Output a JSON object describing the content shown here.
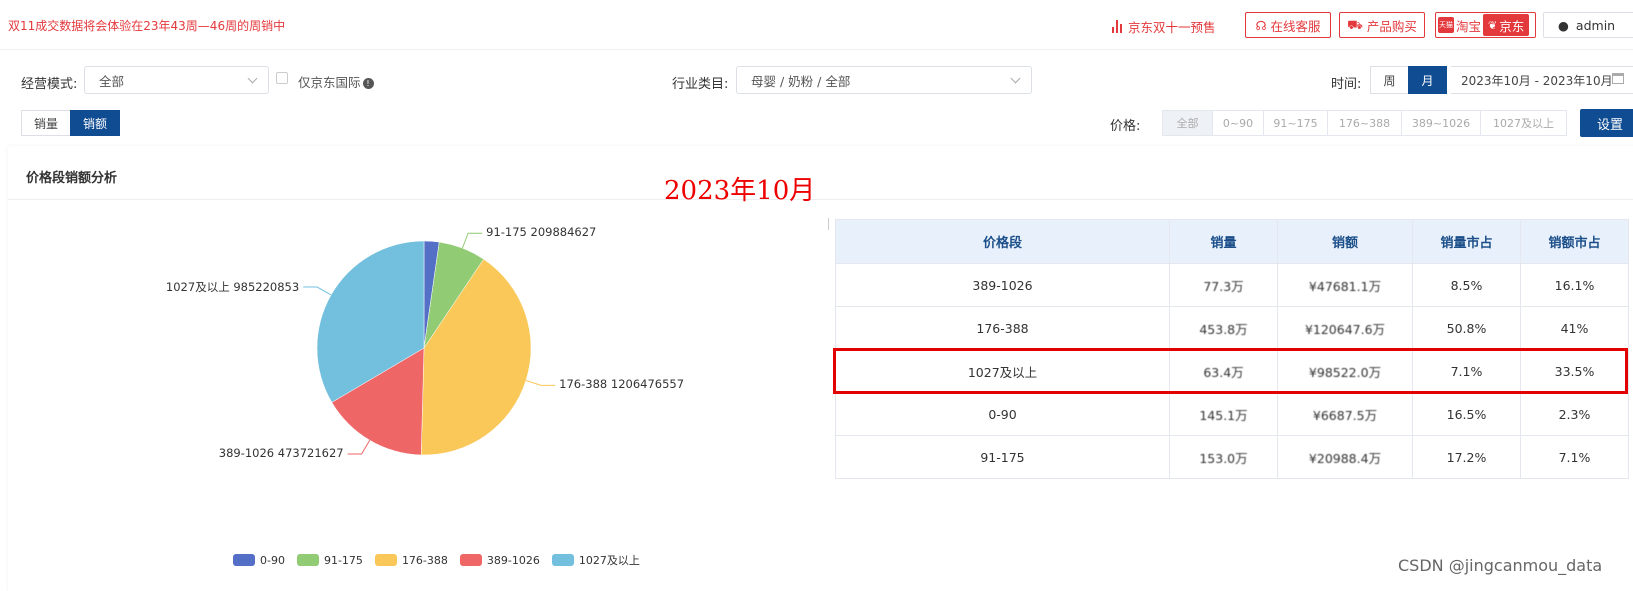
{
  "topbar": {
    "notice": "双11成交数据将会体验在23年43周—46周的周销中",
    "jd_presale": "京东双十一预售",
    "online_service": "在线客服",
    "product_purchase": "产品购买",
    "platform_taobao": "淘宝",
    "platform_taobao_logo": "天猫",
    "platform_jd": "京东",
    "user": "admin"
  },
  "filters": {
    "mode_label": "经营模式:",
    "mode_value": "全部",
    "jd_intl_label": "仅京东国际",
    "industry_label": "行业类目:",
    "industry_value": "母婴 / 奶粉 / 全部",
    "time_label": "时间:",
    "time_week": "周",
    "time_month": "月",
    "date_range": "2023年10月 - 2023年10月",
    "metric_volume": "销量",
    "metric_amount": "销额",
    "price_label": "价格:",
    "price_options": [
      "全部",
      "0~90",
      "91~175",
      "176~388",
      "389~1026",
      "1027及以上"
    ],
    "settings": "设置"
  },
  "card": {
    "title": "价格段销额分析",
    "annotation": "2023年10月"
  },
  "chart_data": {
    "type": "pie",
    "categories": [
      "0-90",
      "91-175",
      "176-388",
      "389-1026",
      "1027及以上"
    ],
    "values": [
      67000000,
      209884627,
      1206476557,
      473721627,
      985220853
    ],
    "labels": [
      "",
      "91-175   209884627",
      "176-388   1206476557",
      "389-1026   473721627",
      "1027及以上   985220853"
    ],
    "colors": [
      "#5470c6",
      "#91cc75",
      "#fac858",
      "#ee6666",
      "#73c0de"
    ],
    "legend": [
      "0-90",
      "91-175",
      "176-388",
      "389-1026",
      "1027及以上"
    ]
  },
  "table": {
    "headers": [
      "价格段",
      "销量",
      "销额",
      "销量市占",
      "销额市占"
    ],
    "rows": [
      [
        "389-1026",
        "77.3万",
        "¥47681.1万",
        "8.5%",
        "16.1%"
      ],
      [
        "176-388",
        "453.8万",
        "¥120647.6万",
        "50.8%",
        "41%"
      ],
      [
        "1027及以上",
        "63.4万",
        "¥98522.0万",
        "7.1%",
        "33.5%"
      ],
      [
        "0-90",
        "145.1万",
        "¥6687.5万",
        "16.5%",
        "2.3%"
      ],
      [
        "91-175",
        "153.0万",
        "¥20988.4万",
        "17.2%",
        "7.1%"
      ]
    ]
  },
  "watermark": "CSDN @jingcanmou_data"
}
